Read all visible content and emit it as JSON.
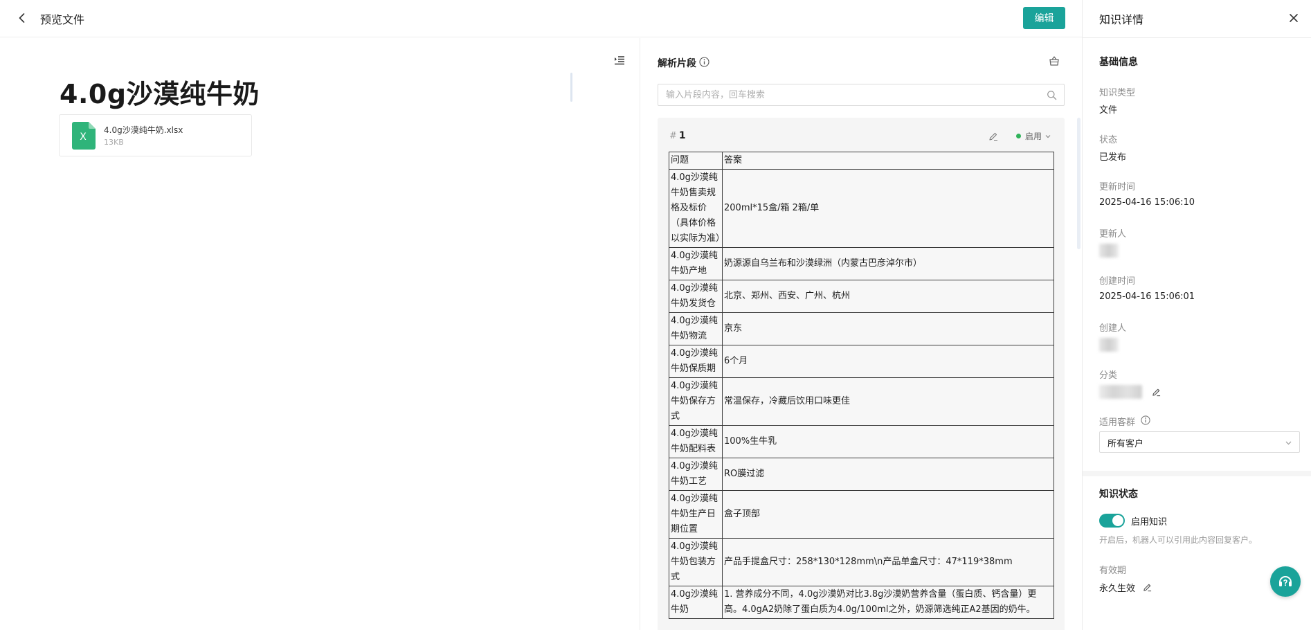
{
  "header": {
    "title": "预览文件",
    "edit_label": "编辑"
  },
  "preview": {
    "doc_title": "4.0g沙漠纯牛奶",
    "file": {
      "icon_letter": "X",
      "name": "4.0g沙漠纯牛奶.xlsx",
      "size": "13KB"
    }
  },
  "segments": {
    "title": "解析片段",
    "search_placeholder": "输入片段内容，回车搜索",
    "card": {
      "index_prefix": "#",
      "index": "1",
      "status": "启用"
    },
    "table": {
      "headers": [
        "问题",
        "答案"
      ],
      "rows": [
        {
          "q": "4.0g沙漠纯牛奶售卖规格及标价（具体价格以实际为准）",
          "a": "200ml*15盒/箱 2箱/单"
        },
        {
          "q": "4.0g沙漠纯牛奶产地",
          "a": "奶源源自乌兰布和沙漠绿洲（内蒙古巴彦淖尔市）"
        },
        {
          "q": "4.0g沙漠纯牛奶发货仓",
          "a": "北京、郑州、西安、广州、杭州"
        },
        {
          "q": "4.0g沙漠纯牛奶物流",
          "a": "京东"
        },
        {
          "q": "4.0g沙漠纯牛奶保质期",
          "a": "6个月"
        },
        {
          "q": "4.0g沙漠纯牛奶保存方式",
          "a": "常温保存，冷藏后饮用口味更佳"
        },
        {
          "q": "4.0g沙漠纯牛奶配料表",
          "a": "100%生牛乳"
        },
        {
          "q": "4.0g沙漠纯牛奶工艺",
          "a": "RO膜过滤"
        },
        {
          "q": "4.0g沙漠纯牛奶生产日期位置",
          "a": "盒子顶部"
        },
        {
          "q": "4.0g沙漠纯牛奶包装方式",
          "a": "产品手提盒尺寸：258*130*128mm\\n产品单盒尺寸：47*119*38mm"
        },
        {
          "q": "4.0g沙漠纯牛奶",
          "a": "1. 营养成分不同，4.0g沙漠奶对比3.8g沙漠奶营养含量（蛋白质、钙含量）更高。4.0gA2奶除了蛋白质为4.0g/100ml之外，奶源筛选纯正A2基因的奶牛。"
        }
      ]
    }
  },
  "detail": {
    "title": "知识详情",
    "basic_info_title": "基础信息",
    "fields": {
      "type_label": "知识类型",
      "type_value": "文件",
      "status_label": "状态",
      "status_value": "已发布",
      "updated_time_label": "更新时间",
      "updated_time_value": "2025-04-16 15:06:10",
      "updater_label": "更新人",
      "created_time_label": "创建时间",
      "created_time_value": "2025-04-16 15:06:01",
      "creator_label": "创建人",
      "category_label": "分类",
      "audience_label": "适用客群",
      "audience_value": "所有客户"
    },
    "knowledge_status_title": "知识状态",
    "enable_label": "启用知识",
    "enable_hint": "开启后，机器人可以引用此内容回复客户。",
    "validity_label": "有效期",
    "validity_value": "永久生效"
  },
  "colors": {
    "accent": "#1aa39a",
    "status_green": "#2fb35a",
    "excel_green": "#2fb47a"
  }
}
